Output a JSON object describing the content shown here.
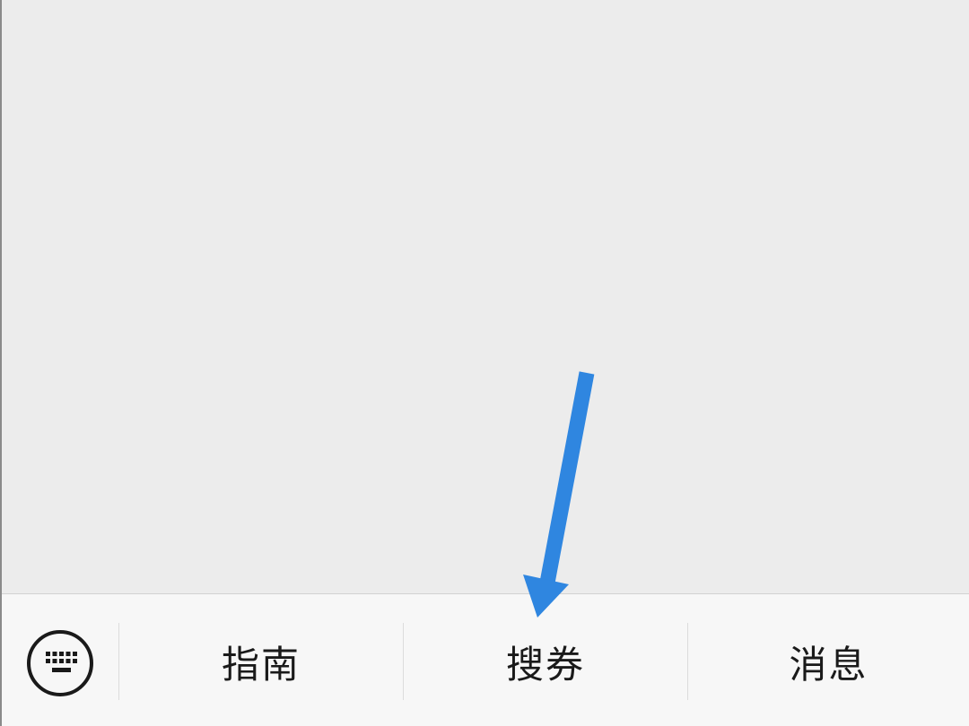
{
  "menu": {
    "items": [
      {
        "label": "指南"
      },
      {
        "label": "搜券"
      },
      {
        "label": "消息"
      }
    ]
  },
  "icons": {
    "keyboard": "keyboard-icon",
    "arrow": "arrow-down-icon"
  },
  "colors": {
    "background": "#ececec",
    "bar_background": "#f7f7f7",
    "arrow": "#2f86e0",
    "text": "#1a1a1a"
  }
}
